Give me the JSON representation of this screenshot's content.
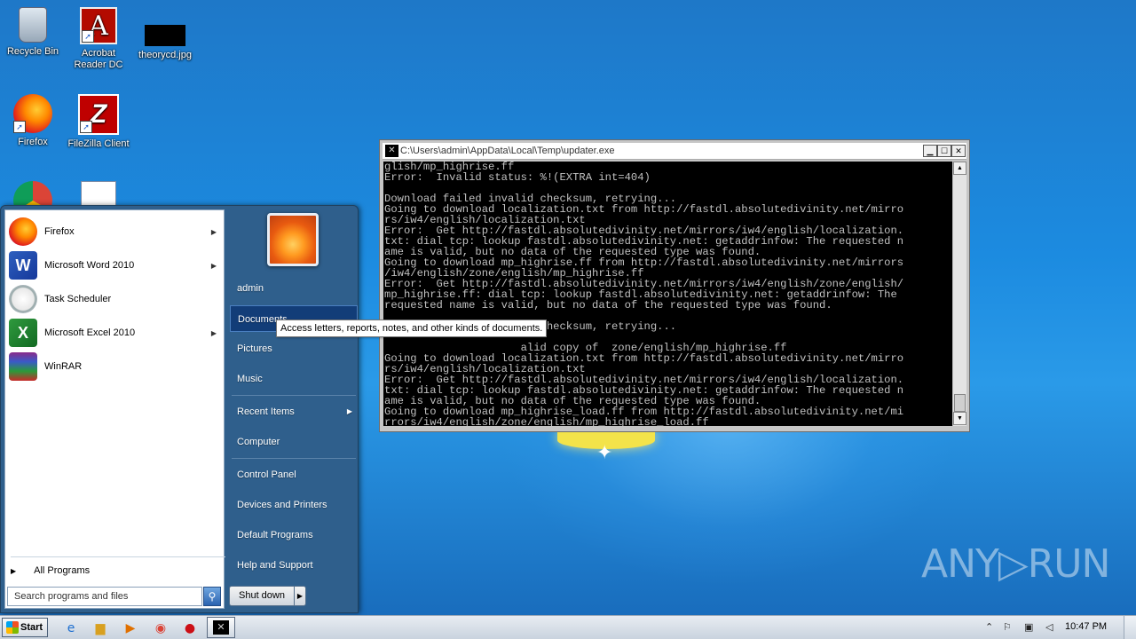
{
  "desktop": {
    "icons": [
      {
        "label": "Recycle Bin"
      },
      {
        "label": "Acrobat Reader DC"
      },
      {
        "label": "theorycd.jpg"
      },
      {
        "label": "Firefox"
      },
      {
        "label": "FileZilla Client"
      }
    ],
    "watermark": "ANY▷RUN"
  },
  "start_menu": {
    "programs": [
      {
        "label": "Firefox",
        "icon": "firefox-icon",
        "has_submenu": true
      },
      {
        "label": "Microsoft Word 2010",
        "icon": "word-icon",
        "has_submenu": true
      },
      {
        "label": "Task Scheduler",
        "icon": "clock-icon",
        "has_submenu": false
      },
      {
        "label": "Microsoft Excel 2010",
        "icon": "excel-icon",
        "has_submenu": true
      },
      {
        "label": "WinRAR",
        "icon": "winrar-icon",
        "has_submenu": false
      }
    ],
    "all_programs": "All Programs",
    "search_placeholder": "Search programs and files",
    "right_items": {
      "user": "admin",
      "documents": "Documents",
      "pictures": "Pictures",
      "music": "Music",
      "recent_items": "Recent Items",
      "computer": "Computer",
      "control_panel": "Control Panel",
      "devices_printers": "Devices and Printers",
      "default_programs": "Default Programs",
      "help_support": "Help and Support"
    },
    "shutdown": "Shut down",
    "tooltip": "Access letters, reports, notes, and other kinds of documents."
  },
  "console": {
    "title": "C:\\Users\\admin\\AppData\\Local\\Temp\\updater.exe",
    "output": "glish/mp_highrise.ff\nError:  Invalid status: %!(EXTRA int=404)\n\nDownload failed invalid checksum, retrying...\nGoing to download localization.txt from http://fastdl.absolutedivinity.net/mirro\nrs/iw4/english/localization.txt\nError:  Get http://fastdl.absolutedivinity.net/mirrors/iw4/english/localization.\ntxt: dial tcp: lookup fastdl.absolutedivinity.net: getaddrinfow: The requested n\name is valid, but no data of the requested type was found.\nGoing to download mp_highrise.ff from http://fastdl.absolutedivinity.net/mirrors\n/iw4/english/zone/english/mp_highrise.ff\nError:  Get http://fastdl.absolutedivinity.net/mirrors/iw4/english/zone/english/\nmp_highrise.ff: dial tcp: lookup fastdl.absolutedivinity.net: getaddrinfow: The\nrequested name is valid, but no data of the requested type was found.\n\nDownload failed invalid checksum, retrying...\n\n                     alid copy of  zone/english/mp_highrise.ff\nGoing to download localization.txt from http://fastdl.absolutedivinity.net/mirro\nrs/iw4/english/localization.txt\nError:  Get http://fastdl.absolutedivinity.net/mirrors/iw4/english/localization.\ntxt: dial tcp: lookup fastdl.absolutedivinity.net: getaddrinfow: The requested n\name is valid, but no data of the requested type was found.\nGoing to download mp_highrise_load.ff from http://fastdl.absolutedivinity.net/mi\nrrors/iw4/english/zone/english/mp_highrise_load.ff"
  },
  "taskbar": {
    "start_label": "Start",
    "clock": "10:47 PM"
  }
}
